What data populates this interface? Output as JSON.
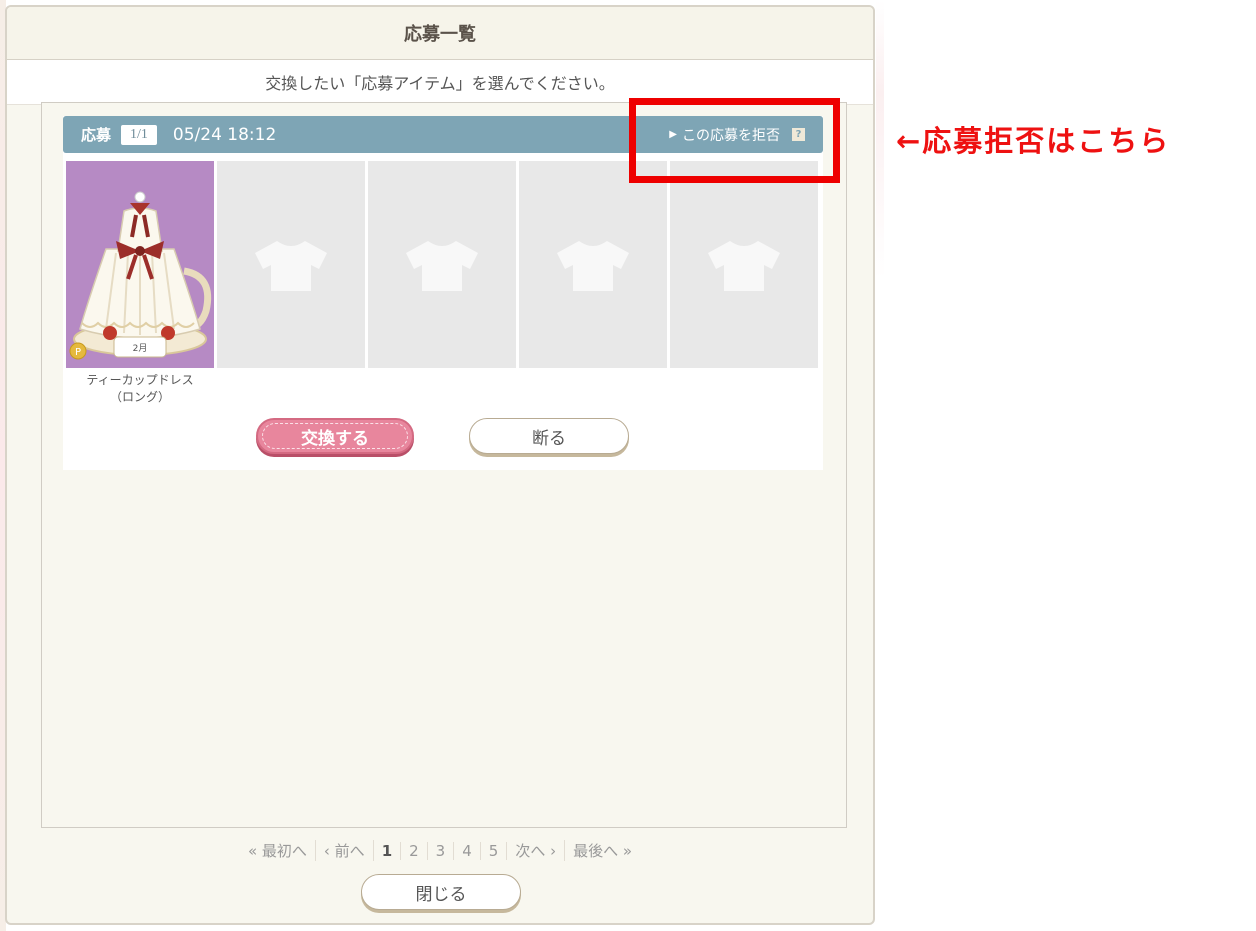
{
  "dialog": {
    "title": "応募一覧",
    "instruction": "交換したい「応募アイテム」を選んでください。"
  },
  "entry": {
    "label": "応募",
    "count": "1/1",
    "date": "05/24 18:12",
    "reject_label": "この応募を拒否",
    "help_icon": "?",
    "item": {
      "name_line1": "ティーカップドレス",
      "name_line2": "（ロング）"
    },
    "exchange_label": "交換する",
    "decline_label": "断る"
  },
  "pager": {
    "first": "« 最初へ",
    "prev": "‹ 前へ",
    "pages": [
      "1",
      "2",
      "3",
      "4",
      "5"
    ],
    "next": "次へ ›",
    "last": "最後へ »"
  },
  "close_label": "閉じる",
  "annotation": "←応募拒否はこちら",
  "colors": {
    "bar": "#7ea5b5",
    "exchange_button": "#e8869d",
    "highlight": "#ee0000"
  }
}
